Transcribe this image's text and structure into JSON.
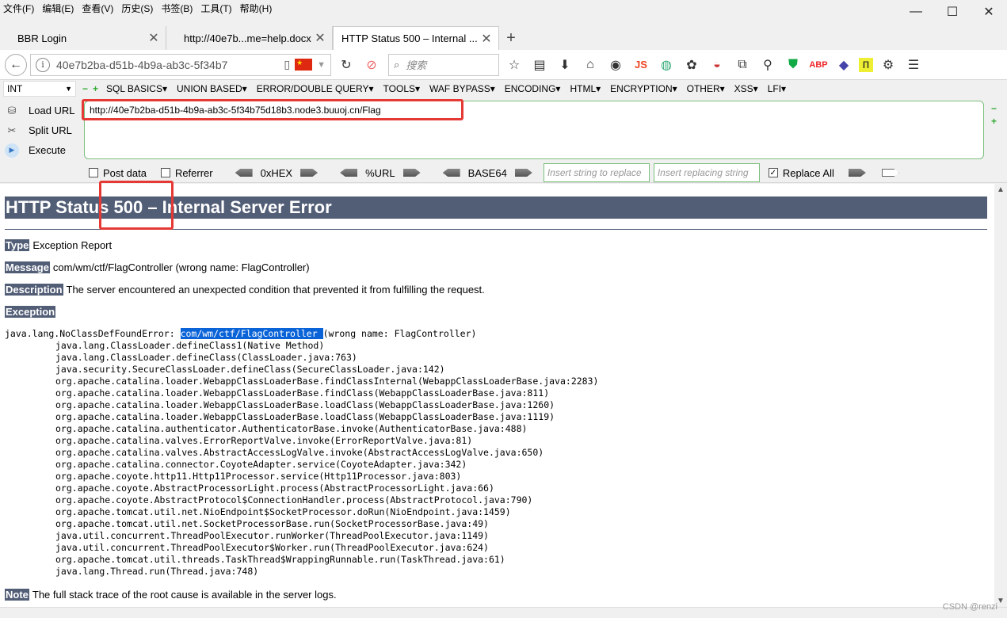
{
  "menu": [
    "文件(F)",
    "编辑(E)",
    "查看(V)",
    "历史(S)",
    "书签(B)",
    "工具(T)",
    "帮助(H)"
  ],
  "window_controls": {
    "minimize": "—",
    "maximize": "☐",
    "close": "✕"
  },
  "tabs": [
    {
      "title": "BBR Login",
      "active": false
    },
    {
      "title": "http://40e7b...me=help.docx",
      "active": false
    },
    {
      "title": "HTTP Status 500 – Internal ...",
      "active": true
    }
  ],
  "navbar": {
    "url": "40e7b2ba-d51b-4b9a-ab3c-5f34b7",
    "search_placeholder": "搜索",
    "js_label": "JS"
  },
  "hackbar": {
    "type_select": "INT",
    "menus": [
      "SQL BASICS▾",
      "UNION BASED▾",
      "ERROR/DOUBLE QUERY▾",
      "TOOLS▾",
      "WAF BYPASS▾",
      "ENCODING▾",
      "HTML▾",
      "ENCRYPTION▾",
      "OTHER▾",
      "XSS▾",
      "LFI▾"
    ],
    "load_url": "Load URL",
    "split_url": "Split URL",
    "execute": "Execute",
    "url_value": "http://40e7b2ba-d51b-4b9a-ab3c-5f34b75d18b3.node3.buuoj.cn/Flag",
    "post_data": "Post data",
    "referrer": "Referrer",
    "hex": "0xHEX",
    "url_enc": "%URL",
    "base64": "BASE64",
    "insert_placeholder": "Insert string to replace",
    "replacing_placeholder": "Insert replacing string",
    "replace_all": "Replace All"
  },
  "page": {
    "heading": "HTTP Status 500 – Internal Server Error",
    "type_label": "Type",
    "type_value": "Exception Report",
    "message_label": "Message",
    "message_value": "com/wm/ctf/FlagController (wrong name: FlagController)",
    "description_label": "Description",
    "description_value": "The server encountered an unexpected condition that prevented it from fulfilling the request.",
    "exception_label": "Exception",
    "exception_prefix": "java.lang.NoClassDefFoundError: ",
    "exception_highlight": "com/wm/ctf/FlagController ",
    "exception_suffix": "(wrong name: FlagController)",
    "stack": [
      "java.lang.ClassLoader.defineClass1(Native Method)",
      "java.lang.ClassLoader.defineClass(ClassLoader.java:763)",
      "java.security.SecureClassLoader.defineClass(SecureClassLoader.java:142)",
      "org.apache.catalina.loader.WebappClassLoaderBase.findClassInternal(WebappClassLoaderBase.java:2283)",
      "org.apache.catalina.loader.WebappClassLoaderBase.findClass(WebappClassLoaderBase.java:811)",
      "org.apache.catalina.loader.WebappClassLoaderBase.loadClass(WebappClassLoaderBase.java:1260)",
      "org.apache.catalina.loader.WebappClassLoaderBase.loadClass(WebappClassLoaderBase.java:1119)",
      "org.apache.catalina.authenticator.AuthenticatorBase.invoke(AuthenticatorBase.java:488)",
      "org.apache.catalina.valves.ErrorReportValve.invoke(ErrorReportValve.java:81)",
      "org.apache.catalina.valves.AbstractAccessLogValve.invoke(AbstractAccessLogValve.java:650)",
      "org.apache.catalina.connector.CoyoteAdapter.service(CoyoteAdapter.java:342)",
      "org.apache.coyote.http11.Http11Processor.service(Http11Processor.java:803)",
      "org.apache.coyote.AbstractProcessorLight.process(AbstractProcessorLight.java:66)",
      "org.apache.coyote.AbstractProtocol$ConnectionHandler.process(AbstractProtocol.java:790)",
      "org.apache.tomcat.util.net.NioEndpoint$SocketProcessor.doRun(NioEndpoint.java:1459)",
      "org.apache.tomcat.util.net.SocketProcessorBase.run(SocketProcessorBase.java:49)",
      "java.util.concurrent.ThreadPoolExecutor.runWorker(ThreadPoolExecutor.java:1149)",
      "java.util.concurrent.ThreadPoolExecutor$Worker.run(ThreadPoolExecutor.java:624)",
      "org.apache.tomcat.util.threads.TaskThread$WrappingRunnable.run(TaskThread.java:61)",
      "java.lang.Thread.run(Thread.java:748)"
    ],
    "note_label": "Note",
    "note_value": "The full stack trace of the root cause is available in the server logs."
  },
  "watermark": "CSDN @renzi"
}
